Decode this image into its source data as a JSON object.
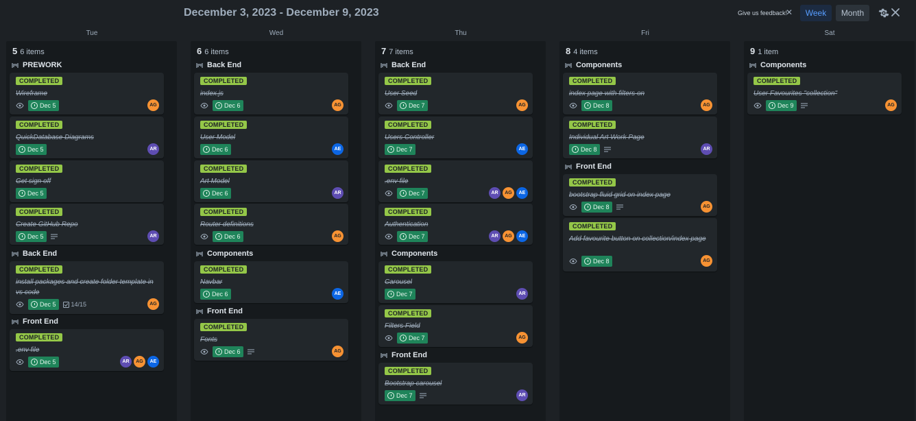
{
  "header": {
    "date_range": "December 3, 2023 - December 9, 2023",
    "feedback_label": "Give us feedback!",
    "week_label": "Week",
    "month_label": "Month"
  },
  "colors": {
    "completed": "#94c748",
    "due": "#1f845a",
    "week_active": "#579dff"
  },
  "days": [
    {
      "header": "Tue",
      "num": "5",
      "count": "6 items"
    },
    {
      "header": "Wed",
      "num": "6",
      "count": "6 items"
    },
    {
      "header": "Thu",
      "num": "7",
      "count": "7 items"
    },
    {
      "header": "Fri",
      "num": "8",
      "count": "4 items"
    },
    {
      "header": "Sat",
      "num": "9",
      "count": "1 item"
    }
  ],
  "groups": {
    "tue_prework": "PREWORK",
    "tue_backend": "Back End",
    "tue_frontend": "Front End",
    "wed_backend": "Back End",
    "wed_components": "Components",
    "wed_frontend": "Front End",
    "thu_backend": "Back End",
    "thu_components": "Components",
    "thu_frontend": "Front End",
    "fri_components": "Components",
    "fri_frontend": "Front End",
    "sat_components": "Components"
  },
  "badge": "COMPLETED",
  "cards": {
    "tue1": {
      "title": "Wireframe",
      "due": "Dec 5",
      "avatars": [
        "AG"
      ]
    },
    "tue2": {
      "title": "QuickDatabase Diagrams",
      "due": "Dec 5",
      "avatars": [
        "AR"
      ]
    },
    "tue3": {
      "title": "Get sign off",
      "due": "Dec 5",
      "avatars": []
    },
    "tue4": {
      "title": "Create GitHub Repo",
      "due": "Dec 5",
      "avatars": [
        "AR"
      ]
    },
    "tue5": {
      "title": "install packages and create folder template in vs code",
      "due": "Dec 5",
      "checklist": "14/15",
      "avatars": [
        "AG"
      ]
    },
    "tue6": {
      "title": ".env file",
      "due": "Dec 5",
      "avatars": [
        "AR",
        "AG",
        "AE"
      ]
    },
    "wed1": {
      "title": "index.js",
      "due": "Dec 6",
      "avatars": [
        "AG"
      ]
    },
    "wed2": {
      "title": "User Model",
      "due": "Dec 6",
      "avatars": [
        "AE"
      ]
    },
    "wed3": {
      "title": "Art Model",
      "due": "Dec 6",
      "avatars": [
        "AR"
      ]
    },
    "wed4": {
      "title": "Router definitions",
      "due": "Dec 6",
      "avatars": [
        "AG"
      ]
    },
    "wed5": {
      "title": "Navbar",
      "due": "Dec 6",
      "avatars": [
        "AE"
      ]
    },
    "wed6": {
      "title": "Fonts",
      "due": "Dec 6",
      "avatars": [
        "AG"
      ]
    },
    "thu1": {
      "title": "User Seed",
      "due": "Dec 7",
      "avatars": [
        "AG"
      ]
    },
    "thu2": {
      "title": "Users Controller",
      "due": "Dec 7",
      "avatars": [
        "AE"
      ]
    },
    "thu3": {
      "title": ".env file",
      "due": "Dec 7",
      "avatars": [
        "AR",
        "AG",
        "AE"
      ]
    },
    "thu4": {
      "title": "Authentication",
      "due": "Dec 7",
      "avatars": [
        "AR",
        "AG",
        "AE"
      ]
    },
    "thu5": {
      "title": "Carousel",
      "due": "Dec 7",
      "avatars": [
        "AR"
      ]
    },
    "thu6": {
      "title": "Filters Field",
      "due": "Dec 7",
      "avatars": [
        "AG"
      ]
    },
    "thu7": {
      "title": "Bootstrap carousel",
      "due": "Dec 7",
      "avatars": [
        "AR"
      ]
    },
    "fri1": {
      "title": "index page with filters on",
      "due": "Dec 8",
      "avatars": [
        "AG"
      ]
    },
    "fri2": {
      "title": "Individual Art Work Page",
      "due": "Dec 8",
      "avatars": [
        "AR"
      ]
    },
    "fri3": {
      "title": "bootstrap fluid grid on index page",
      "due": "Dec 8",
      "avatars": [
        "AG"
      ]
    },
    "fri4": {
      "title": "Add favourite button on collection/index page",
      "due": "Dec 8",
      "avatars": [
        "AG"
      ]
    },
    "sat1": {
      "title": "User Favourites \"collection\"",
      "due": "Dec 9",
      "avatars": [
        "AG"
      ]
    }
  }
}
